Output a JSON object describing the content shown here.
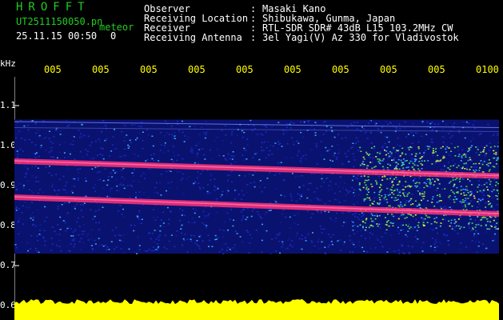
{
  "header": {
    "app_title": "HROFFT",
    "file_name": "UT2511150050.pn",
    "meteor_label": "meteor",
    "datetime": "25.11.15 00:50",
    "extra": "0"
  },
  "info": {
    "rows": [
      {
        "label": "Observer",
        "value": "Masaki Kano"
      },
      {
        "label": "Receiving Location",
        "value": "Shibukawa, Gunma, Japan"
      },
      {
        "label": "Receiver",
        "value": "RTL-SDR SDR# 43dB L15 103.2MHz CW"
      },
      {
        "label": "Receiving Antenna",
        "value": "3el Yagi(V) Az 330 for Vladivostok"
      }
    ]
  },
  "axis": {
    "unit": "kHz",
    "y_ticks": [
      "1.1",
      "1.0",
      "0.9",
      "0.8",
      "0.7",
      "0.6"
    ],
    "x_ticks": [
      "005",
      "005",
      "005",
      "005",
      "005",
      "005",
      "005",
      "005",
      "005",
      "0100"
    ]
  },
  "spectrogram": {
    "freq_range_khz": [
      0.6,
      1.1
    ],
    "band_khz": [
      0.73,
      1.065
    ],
    "bright_lines_khz": [
      {
        "start": 0.962,
        "end": 0.925
      },
      {
        "start": 0.872,
        "end": 0.83
      }
    ],
    "colors": {
      "background": "#000000",
      "noise": "#1a2cc8",
      "noise_bright": "#33aaff",
      "line": "#ff3377",
      "activity": "#55dd55",
      "baseline": "#ffff00"
    }
  }
}
